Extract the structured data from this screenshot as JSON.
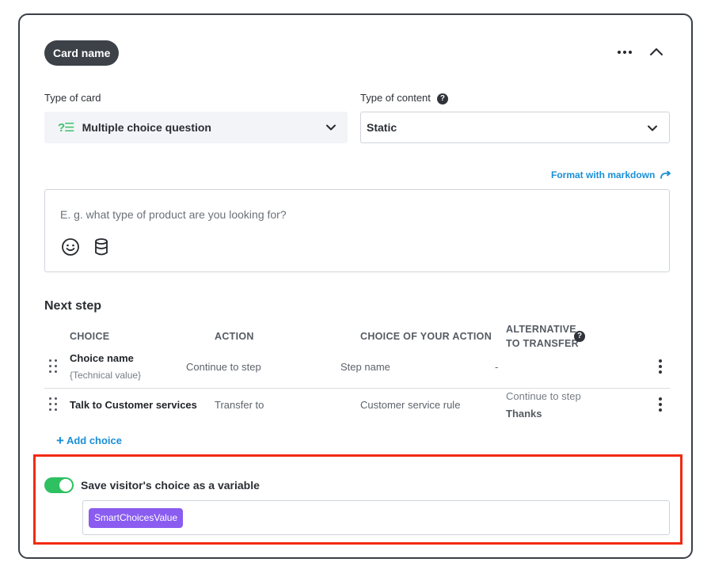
{
  "card": {
    "name": "Card name",
    "type_of_card_label": "Type of card",
    "type_of_card_value": "Multiple choice question",
    "type_of_card_icon": "multiple-choice-icon",
    "type_of_content_label": "Type of content",
    "type_of_content_value": "Static",
    "format_markdown_link": "Format with markdown",
    "message_placeholder": "E. g. what type of product are you looking for?"
  },
  "next_step": {
    "title": "Next step",
    "headers": {
      "choice": "CHOICE",
      "action": "ACTION",
      "choice_of_action": "CHOICE OF YOUR ACTION",
      "alternative_line1": "ALTERNATIVE",
      "alternative_line2": "TO TRANSFER"
    },
    "rows": [
      {
        "choice": "Choice name",
        "technical": "{Technical value}",
        "action": "Continue to step",
        "choice_of_action": "Step name",
        "alternative": "-"
      },
      {
        "choice": "Talk to Customer services",
        "action": "Transfer to",
        "choice_of_action": "Customer service rule",
        "alternative_label": "Continue to step",
        "alternative_value": "Thanks"
      }
    ],
    "add_choice": "Add choice"
  },
  "variable": {
    "toggle_label": "Save visitor's choice as a variable",
    "toggle_on": true,
    "chip": "SmartChoicesValue"
  },
  "colors": {
    "accent": "#1a8fd6",
    "toggle_on": "#2ec061",
    "chip": "#8a5cf0",
    "highlight": "#f22a12"
  }
}
